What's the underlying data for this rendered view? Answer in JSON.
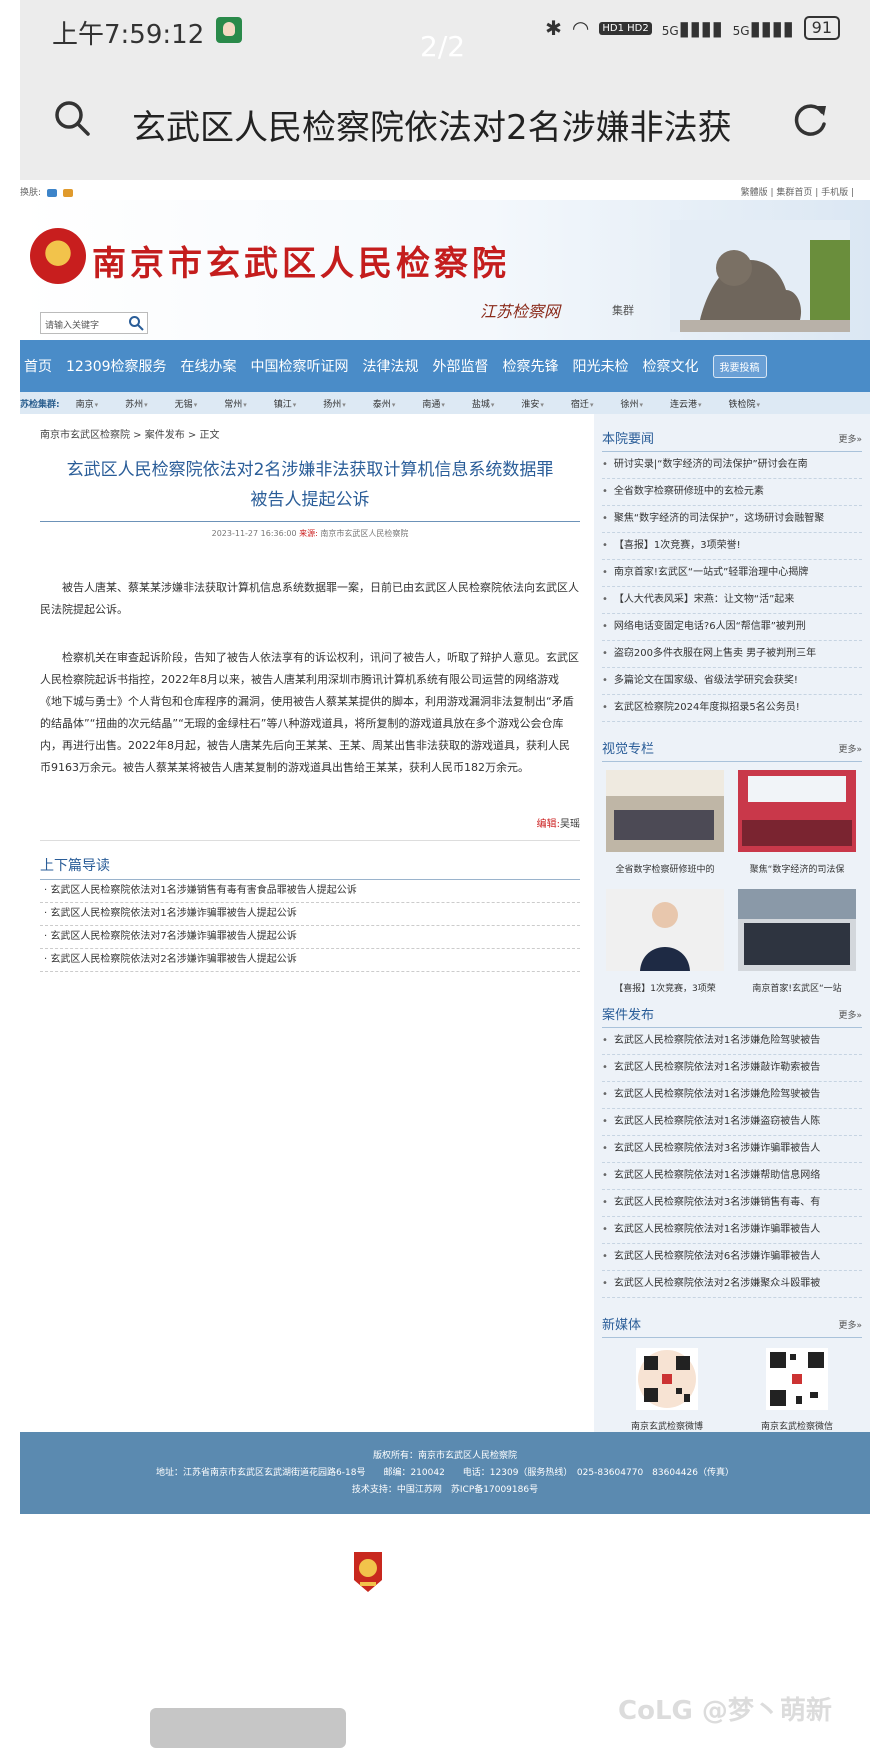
{
  "status": {
    "time": "上午7:59:12",
    "page_indicator": "2/2",
    "hd": "HD1 HD2",
    "net1": "5G",
    "net2": "5G",
    "battery": "91"
  },
  "browser": {
    "query": "玄武区人民检察院依法对2名涉嫌非法获"
  },
  "topstrip": {
    "skin_label": "换肤:",
    "links": "繁體版 | 集群首页 | 手机版 |"
  },
  "header": {
    "site_name": "南京市玄武区人民检察院",
    "search_placeholder": "请输入关键字",
    "sub_logo": "江苏检察网",
    "sub_logo_suffix": "集群"
  },
  "nav": {
    "items": [
      "首页",
      "12309检察服务",
      "在线办案",
      "中国检察听证网",
      "法律法规",
      "外部监督",
      "检察先锋",
      "阳光未检",
      "检察文化"
    ],
    "submit": "我要投稿"
  },
  "citybar": {
    "label": "苏检集群:",
    "cities": [
      "南京",
      "苏州",
      "无锡",
      "常州",
      "镇江",
      "扬州",
      "泰州",
      "南通",
      "盐城",
      "淮安",
      "宿迁",
      "徐州",
      "连云港",
      "铁检院"
    ]
  },
  "article": {
    "breadcrumb": "南京市玄武区检察院 > 案件发布 > 正文",
    "title_line1": "玄武区人民检察院依法对2名涉嫌非法获取计算机信息系统数据罪",
    "title_line2": "被告人提起公诉",
    "date": "2023-11-27 16:36:00",
    "source_label": "来源:",
    "source": "南京市玄武区人民检察院",
    "p1": "被告人唐某、蔡某某涉嫌非法获取计算机信息系统数据罪一案，日前已由玄武区人民检察院依法向玄武区人民法院提起公诉。",
    "p2": "检察机关在审查起诉阶段，告知了被告人依法享有的诉讼权利，讯问了被告人，听取了辩护人意见。玄武区人民检察院起诉书指控，2022年8月以来，被告人唐某利用深圳市腾讯计算机系统有限公司运营的网络游戏《地下城与勇士》个人背包和仓库程序的漏洞，使用被告人蔡某某提供的脚本，利用游戏漏洞非法复制出“矛盾的结晶体”“扭曲的次元结晶”“无瑕的金绿柱石”等八种游戏道具，将所复制的游戏道具放在多个游戏公会仓库内，再进行出售。2022年8月起，被告人唐某先后向王某某、王某、周某出售非法获取的游戏道具，获利人民币9163万余元。被告人蔡某某将被告人唐某复制的游戏道具出售给王某某，获利人民币182万余元。",
    "editor_label": "编辑:",
    "editor": "吴瑶",
    "related_title": "上下篇导读",
    "related": [
      "· 玄武区人民检察院依法对1名涉嫌销售有毒有害食品罪被告人提起公诉",
      "· 玄武区人民检察院依法对1名涉嫌诈骗罪被告人提起公诉",
      "· 玄武区人民检察院依法对7名涉嫌诈骗罪被告人提起公诉",
      "· 玄武区人民检察院依法对2名涉嫌诈骗罪被告人提起公诉"
    ]
  },
  "sidebar": {
    "more": "更多»",
    "news_title": "本院要闻",
    "news": [
      "研讨实录|“数字经济的司法保护”研讨会在南",
      "全省数字检察研修班中的玄检元素",
      "聚焦“数字经济的司法保护”，这场研讨会融智聚",
      "【喜报】1次竞赛，3项荣誉!",
      "南京首家!玄武区“一站式”轻罪治理中心揭牌",
      "【人大代表风采】宋燕：让文物“活”起来",
      "网络电话变固定电话?6人因“帮信罪”被判刑",
      "盗窃200多件衣服在网上售卖 男子被判刑三年",
      "多篇论文在国家级、省级法学研究会获奖!",
      "玄武区检察院2024年度拟招录5名公务员!"
    ],
    "visual_title": "视觉专栏",
    "photos": [
      "全省数字检察研修班中的",
      "聚焦“数字经济的司法保",
      "【喜报】1次竞赛，3项荣",
      "南京首家!玄武区“一站"
    ],
    "cases_title": "案件发布",
    "cases": [
      "玄武区人民检察院依法对1名涉嫌危险驾驶被告",
      "玄武区人民检察院依法对1名涉嫌敲诈勒索被告",
      "玄武区人民检察院依法对1名涉嫌危险驾驶被告",
      "玄武区人民检察院依法对1名涉嫌盗窃被告人陈",
      "玄武区人民检察院依法对3名涉嫌诈骗罪被告人",
      "玄武区人民检察院依法对1名涉嫌帮助信息网络",
      "玄武区人民检察院依法对3名涉嫌销售有毒、有",
      "玄武区人民检察院依法对1名涉嫌诈骗罪被告人",
      "玄武区人民检察院依法对6名涉嫌诈骗罪被告人",
      "玄武区人民检察院依法对2名涉嫌聚众斗殴罪被"
    ],
    "media_title": "新媒体",
    "media": [
      "南京玄武检察微博",
      "南京玄武检察微信"
    ]
  },
  "footer": {
    "line1": "版权所有：南京市玄武区人民检察院",
    "line2": "地址：江苏省南京市玄武区玄武湖街道花园路6-18号　　邮编：210042　　电话：12309（服务热线）　025-83604770　83604426（传真）",
    "line3": "技术支持：中国江苏网　苏ICP备17009186号"
  },
  "watermark": "CoLG @梦丶萌新"
}
